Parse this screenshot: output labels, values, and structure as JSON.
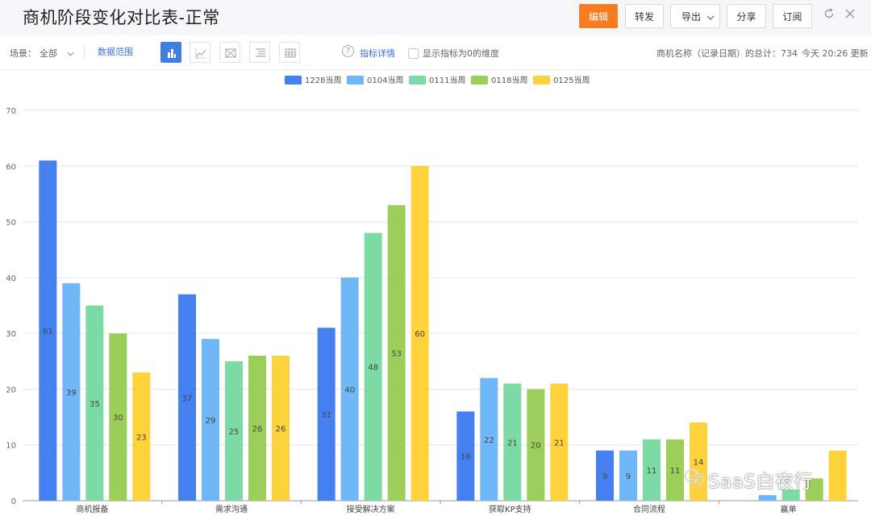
{
  "header": {
    "title": "商机阶段变化对比表-正常",
    "buttons": {
      "edit": "编辑",
      "forward": "转发",
      "export": "导出",
      "share": "分享",
      "subscribe": "订阅"
    }
  },
  "toolbar": {
    "scene_label": "场景：",
    "scene_value": "全部",
    "data_range": "数据范围",
    "metric_detail": "指标详情",
    "show_zero_label": "显示指标为0的维度",
    "total_text": "商机名称（记录日期）的总计：734",
    "update_text": "今天 20:26 更新"
  },
  "watermark": "SaaS白夜行",
  "chart_data": {
    "type": "bar",
    "categories": [
      "商机报备",
      "需求沟通",
      "接受解决方案",
      "获取KP支持",
      "合同流程",
      "赢单"
    ],
    "series": [
      {
        "name": "1228当周",
        "color": "#4580f0",
        "values": [
          61,
          37,
          31,
          16,
          9,
          0
        ]
      },
      {
        "name": "0104当周",
        "color": "#6fb7f7",
        "values": [
          39,
          29,
          40,
          22,
          9,
          1
        ]
      },
      {
        "name": "0111当周",
        "color": "#7cdba4",
        "values": [
          35,
          25,
          48,
          21,
          11,
          2
        ]
      },
      {
        "name": "0118当周",
        "color": "#9ccf5a",
        "values": [
          30,
          26,
          53,
          20,
          11,
          4
        ]
      },
      {
        "name": "0125当周",
        "color": "#fdd23b",
        "values": [
          23,
          26,
          60,
          21,
          14,
          9
        ]
      }
    ],
    "ylim": [
      0,
      70
    ],
    "yticks": [
      0,
      10,
      20,
      30,
      40,
      50,
      60,
      70
    ],
    "grid": true,
    "legend": "top-center",
    "data_labels": [
      [
        "61",
        "37",
        "31",
        "16",
        "9",
        ""
      ],
      [
        "39",
        "29",
        "40",
        "22",
        "9",
        ""
      ],
      [
        "35",
        "25",
        "48",
        "21",
        "11",
        ""
      ],
      [
        "30",
        "26",
        "53",
        "20",
        "11",
        ""
      ],
      [
        "23",
        "26",
        "60",
        "21",
        "14",
        ""
      ]
    ]
  }
}
